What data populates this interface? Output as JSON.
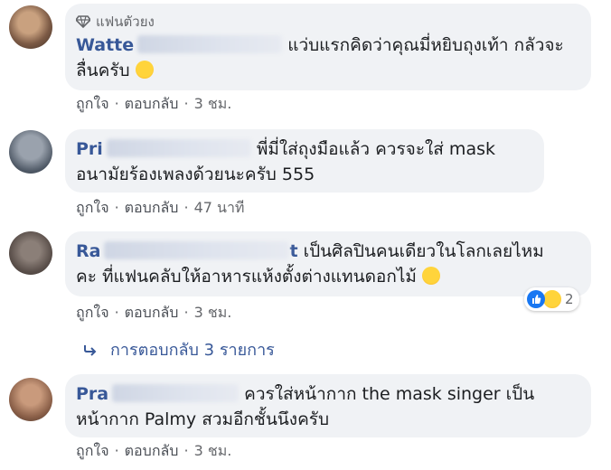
{
  "comments": [
    {
      "badge": "แฟนตัวยง",
      "name_prefix": "Watte",
      "name_suffix": "",
      "text_line1": "แว่บแรกคิดว่าคุณมี่หยิบถุงเท้า กลัวจะ",
      "text_line2": "ลื่นครับ",
      "actions": {
        "like": "ถูกใจ",
        "reply": "ตอบกลับ",
        "time": "3 ชม."
      }
    },
    {
      "name_prefix": "Pri",
      "name_suffix": "",
      "text_line1": "พี่มี่ใส่ถุงมือแล้ว ควรจะใส่ mask",
      "text_line2": "อนามัยร้องเพลงด้วยนะครับ 555",
      "actions": {
        "like": "ถูกใจ",
        "reply": "ตอบกลับ",
        "time": "47 นาที"
      }
    },
    {
      "name_prefix": "Ra",
      "name_suffix": "t",
      "text_line1": "เป็นศิลปินคนเดียวในโลกเลยไหม",
      "text_line2": "คะ ที่แฟนคลับให้อาหารแห้งตั้งต่างแทนดอกไม้",
      "reaction_count": "2",
      "actions": {
        "like": "ถูกใจ",
        "reply": "ตอบกลับ",
        "time": "3 ชม."
      },
      "replies_label": "การตอบกลับ 3 รายการ"
    },
    {
      "name_prefix": "Pra",
      "name_suffix": "",
      "text_line1": "ควรใส่หน้ากาก the mask singer เป็น",
      "text_line2": "หน้ากาก Palmy สวมอีกชั้นนึงครับ",
      "actions": {
        "like": "ถูกใจ",
        "reply": "ตอบกลับ",
        "time": "3 ชม."
      }
    }
  ],
  "separator": "·",
  "colors": {
    "bubble": "#f0f2f5",
    "name": "#385898",
    "meta": "#65676b"
  }
}
